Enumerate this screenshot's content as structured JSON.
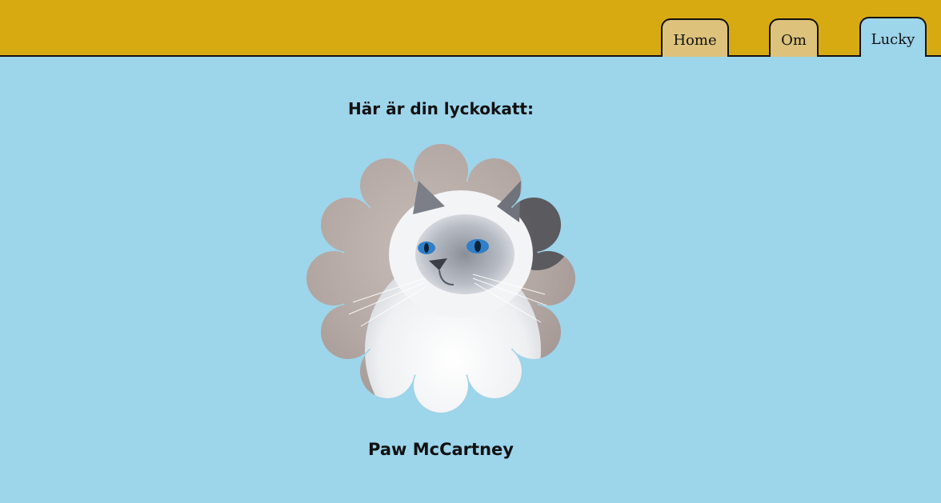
{
  "nav": {
    "tabs": [
      {
        "label": "Home"
      },
      {
        "label": "Om"
      },
      {
        "label": "Lucky"
      }
    ],
    "active_tab": "Lucky"
  },
  "main": {
    "heading": "Här är din lyckokatt:",
    "cat_name": "Paw McCartney",
    "image_subject": "cat-photo"
  },
  "colors": {
    "header_bg": "#d8aa12",
    "page_bg": "#9dd5eb",
    "tab_bg": "#dcc27b"
  }
}
